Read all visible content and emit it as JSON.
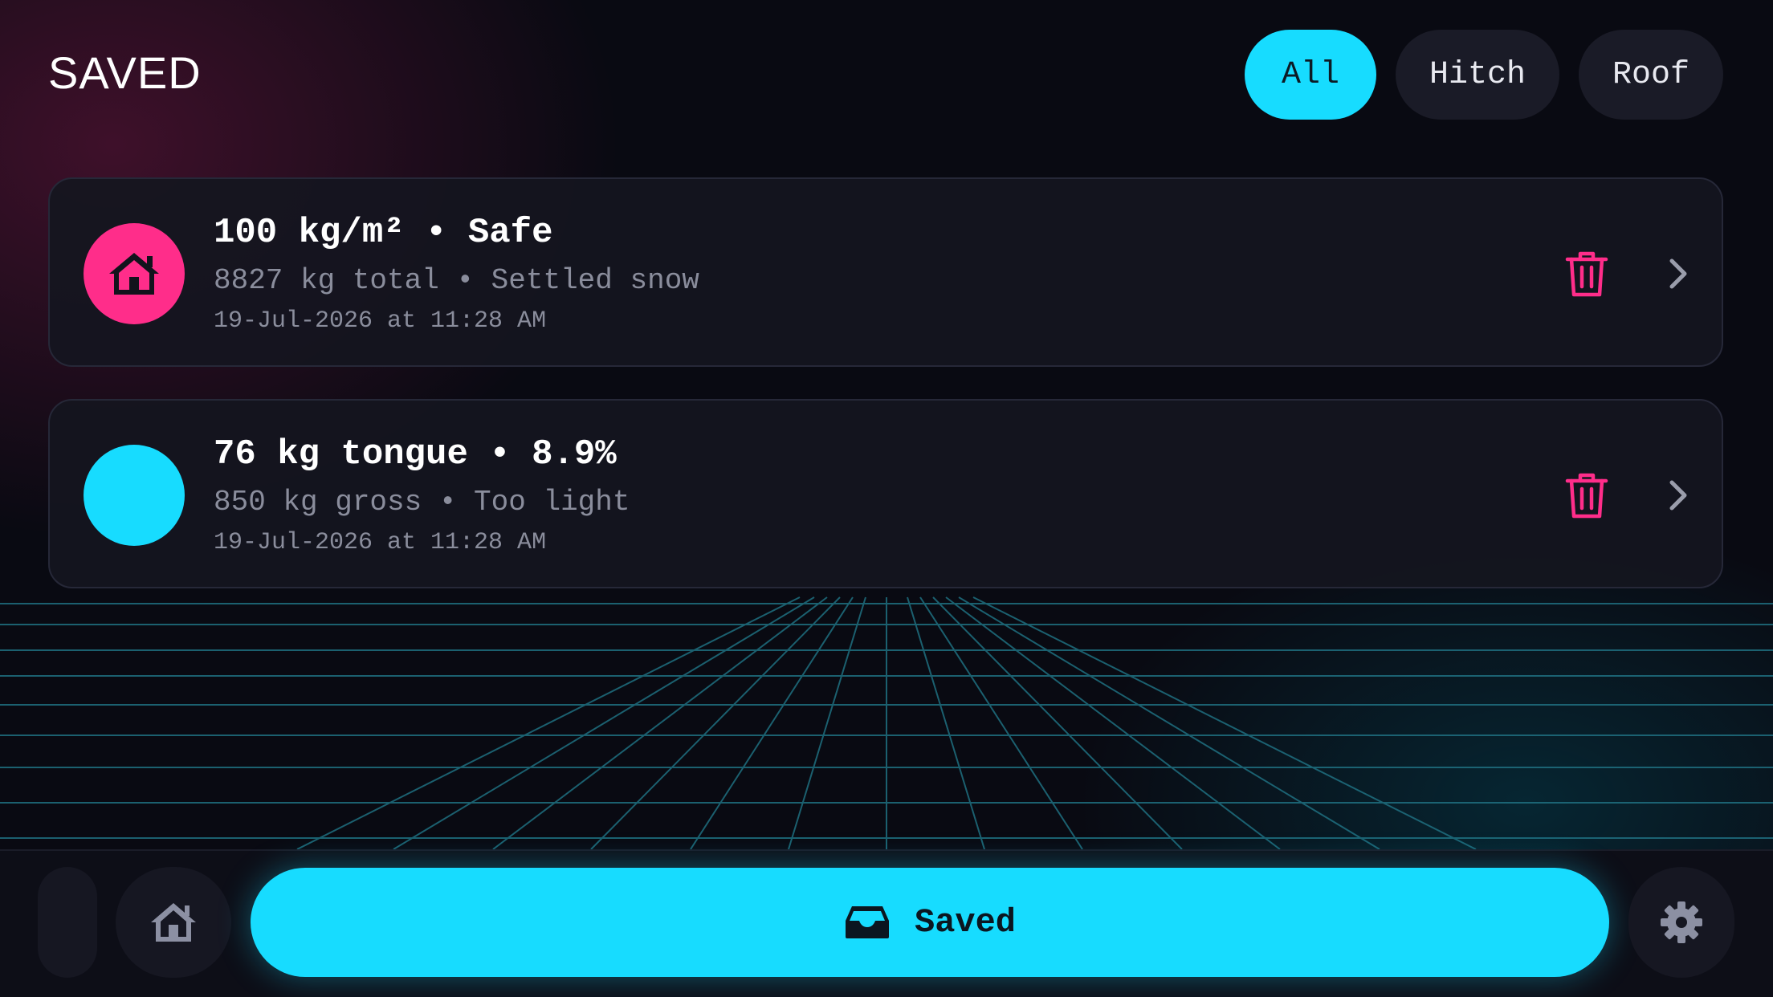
{
  "header": {
    "title": "SAVED"
  },
  "filters": {
    "items": [
      {
        "label": "All",
        "active": true
      },
      {
        "label": "Hitch",
        "active": false
      },
      {
        "label": "Roof",
        "active": false
      }
    ]
  },
  "saved_items": [
    {
      "icon": "house-icon",
      "accent": "#ff2d8a",
      "title": "100 kg/m² • Safe",
      "subtitle": "8827 kg total • Settled snow",
      "timestamp": "19-Jul-2026 at 11:28 AM"
    },
    {
      "icon": "",
      "accent": "#17dcff",
      "title": "76 kg tongue • 8.9%",
      "subtitle": "850 kg gross • Too light",
      "timestamp": "19-Jul-2026 at 11:28 AM"
    }
  ],
  "bottom_nav": {
    "saved_label": "Saved",
    "icons": [
      "home-icon",
      "inbox-tray-icon",
      "gear-icon"
    ]
  },
  "colors": {
    "accent_cyan": "#17dcff",
    "accent_pink": "#ff2d8a",
    "card_bg": "#14151f",
    "page_bg": "#090a12"
  }
}
